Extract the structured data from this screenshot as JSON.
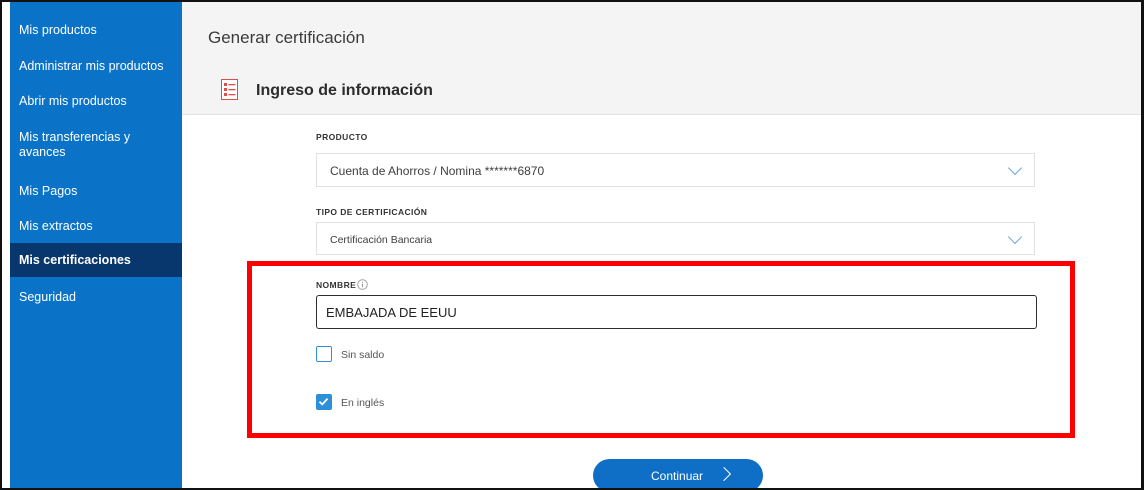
{
  "sidebar": {
    "items": [
      {
        "label": "Mis productos"
      },
      {
        "label": "Administrar mis productos"
      },
      {
        "label": "Abrir mis productos"
      },
      {
        "label": "Mis transferencias y avances"
      },
      {
        "label": "Mis Pagos"
      },
      {
        "label": "Mis extractos"
      },
      {
        "label": "Mis certificaciones"
      },
      {
        "label": "Seguridad"
      }
    ]
  },
  "header": {
    "title": "Generar certificación"
  },
  "section": {
    "title": "Ingreso de información",
    "icon": "form-list-icon"
  },
  "form": {
    "producto": {
      "label": "PRODUCTO",
      "value": "Cuenta de Ahorros / Nomina *******6870"
    },
    "tipo": {
      "label": "TIPO DE CERTIFICACIÓN",
      "value": "Certificación Bancaria"
    },
    "nombre": {
      "label": "NOMBRE",
      "value": "EMBAJADA DE EEUU",
      "info_icon": "info-icon"
    },
    "sin_saldo": {
      "label": "Sin saldo",
      "checked": false
    },
    "en_ingles": {
      "label": "En inglés",
      "checked": true
    },
    "continue_label": "Continuar"
  },
  "colors": {
    "sidebar": "#0a73c7",
    "sidebar_active": "#08376e",
    "button": "#0f6ec5",
    "highlight": "#ff0000"
  }
}
